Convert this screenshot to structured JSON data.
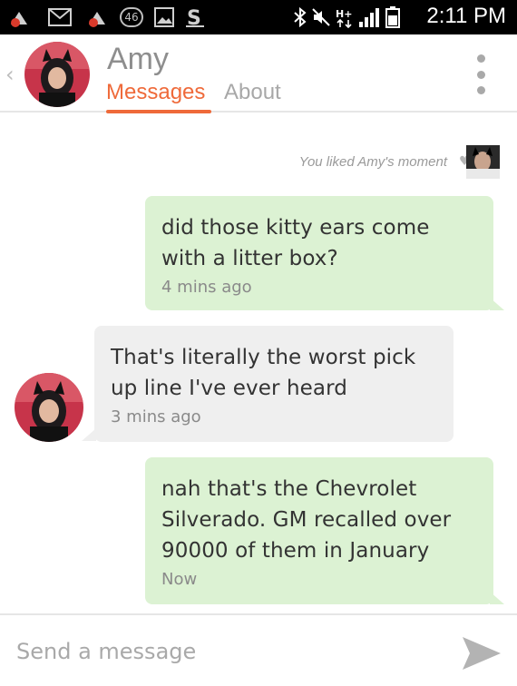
{
  "status_bar": {
    "time": "2:11 PM",
    "badge_count": "46",
    "icons": [
      "notification-icon",
      "mail-icon",
      "notification-icon",
      "count-badge",
      "image-icon",
      "s-app-icon",
      "bluetooth-icon",
      "mute-icon",
      "data-hplus-icon",
      "signal-icon",
      "battery-icon"
    ]
  },
  "header": {
    "contact_name": "Amy",
    "tabs": [
      {
        "label": "Messages",
        "active": true
      },
      {
        "label": "About",
        "active": false
      }
    ],
    "accent_color": "#ef6a3a"
  },
  "chat": {
    "liked_text": "You liked Amy's moment",
    "messages": [
      {
        "direction": "outgoing",
        "text": "did those kitty ears come with a litter box?",
        "lines": [
          "did those kitty ears come",
          "with a litter box?"
        ],
        "time": "4 mins ago"
      },
      {
        "direction": "incoming",
        "text": "That's literally the worst pick up line I've ever heard",
        "lines": [
          "That's literally the worst pick",
          "up line I've ever heard"
        ],
        "time": "3 mins ago"
      },
      {
        "direction": "outgoing",
        "text": "nah that's the Chevrolet Silverado. GM recalled over 90000 of them in January",
        "lines": [
          "nah that's the Chevrolet",
          "Silverado. GM recalled over",
          "90000 of them in January"
        ],
        "time": "Now"
      }
    ],
    "colors": {
      "outgoing": "#dcf2d3",
      "incoming": "#efefef"
    }
  },
  "composer": {
    "placeholder": "Send a message",
    "value": ""
  }
}
